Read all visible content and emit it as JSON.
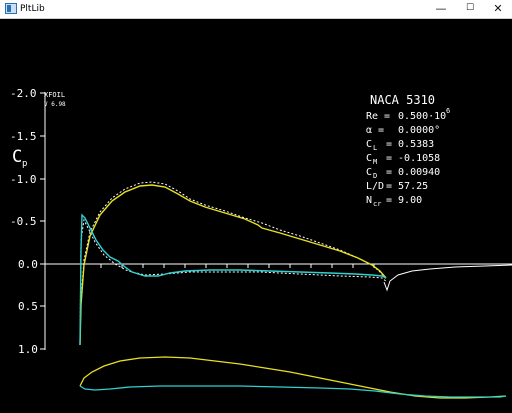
{
  "window": {
    "title": "PltLib",
    "minimize_glyph": "—",
    "maximize_glyph": "☐",
    "close_glyph": "✕"
  },
  "plot": {
    "axis_label_main": "C",
    "axis_label_sub": "p",
    "y_ticks": [
      "-2.0",
      "-1.5",
      "-1.0",
      "-0.5",
      "0.0",
      "0.5",
      "1.0"
    ],
    "program": "XFOIL",
    "version": "V 6.98"
  },
  "info": {
    "airfoil": "NACA 5310",
    "re_label": "Re =",
    "re_value": "0.500·10",
    "re_exp": "6",
    "alpha_label": "α =",
    "alpha_value": "0.0000°",
    "cl_label": "C",
    "cl_sub": "L",
    "cl_value": "= 0.5383",
    "cm_label": "C",
    "cm_sub": "M",
    "cm_value": "= -0.1058",
    "cd_label": "C",
    "cd_sub": "D",
    "cd_value": "= 0.00940",
    "ld_label": "L/D",
    "ld_value": "= 57.25",
    "ncr_label": "N",
    "ncr_sub": "cr",
    "ncr_value": "= 9.00"
  },
  "colors": {
    "upper": "#e8e020",
    "lower": "#30d0d0",
    "inviscid": "#ffffff",
    "background": "#000000"
  }
}
